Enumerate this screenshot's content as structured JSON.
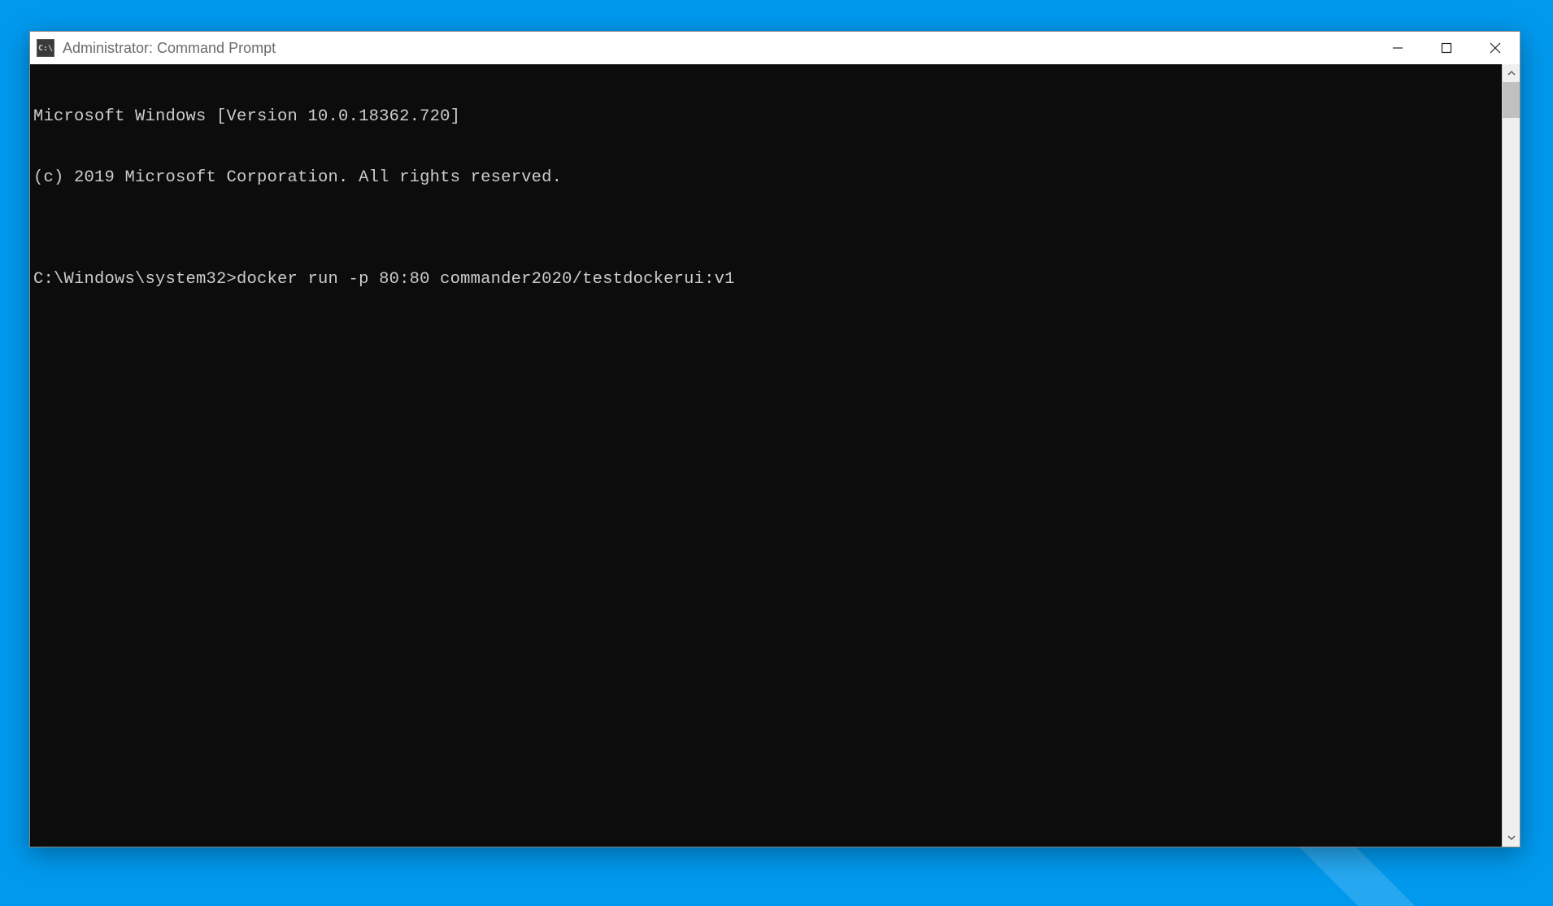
{
  "window": {
    "title": "Administrator: Command Prompt",
    "icon_name": "cmd-prompt-icon",
    "icon_glyph": "C:\\"
  },
  "console": {
    "lines": [
      "Microsoft Windows [Version 10.0.18362.720]",
      "(c) 2019 Microsoft Corporation. All rights reserved.",
      "",
      "C:\\Windows\\system32>docker run -p 80:80 commander2020/testdockerui:v1"
    ]
  },
  "colors": {
    "console_bg": "#0c0c0c",
    "console_fg": "#cccccc",
    "desktop": "#0099ee",
    "titlebar_fg": "#6b6b6b"
  }
}
